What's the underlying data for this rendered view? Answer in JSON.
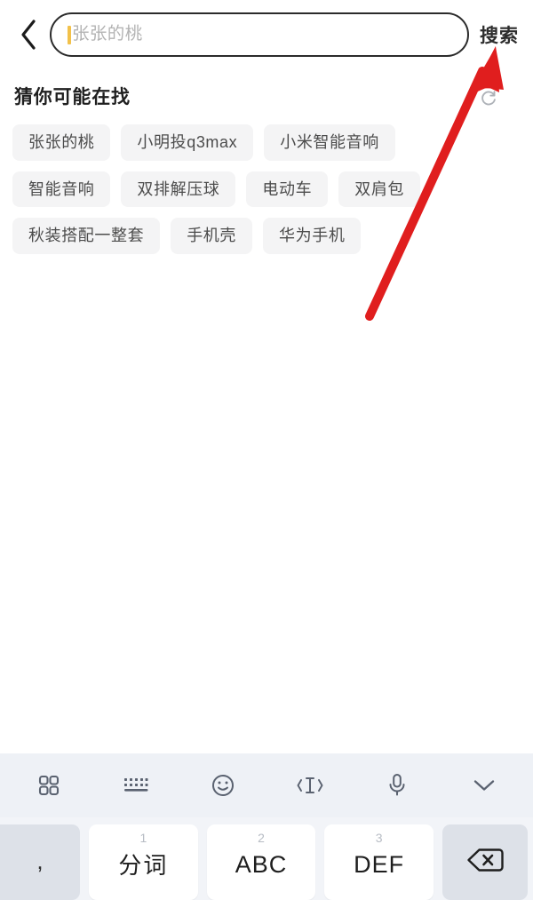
{
  "header": {
    "back_icon": "chevron-left-icon",
    "search_input": {
      "value": "",
      "placeholder": "张张的桃",
      "caret_color": "#f2c14a"
    },
    "search_button_label": "搜索"
  },
  "suggestions": {
    "title": "猜你可能在找",
    "refresh_icon": "refresh-icon",
    "rows": [
      [
        "张张的桃",
        "小明投q3max",
        "小米智能音响"
      ],
      [
        "智能音响",
        "双排解压球",
        "电动车",
        "双肩包"
      ],
      [
        "秋装搭配一整套",
        "手机壳",
        "华为手机"
      ]
    ]
  },
  "keyboard": {
    "toolbar_icons": [
      "grid-apps-icon",
      "keyboard-icon",
      "emoji-smiley-icon",
      "text-cursor-icon",
      "microphone-icon",
      "chevron-down-icon"
    ],
    "keys": [
      {
        "name": "comma-key",
        "label": ",",
        "num": ""
      },
      {
        "name": "fenci-key",
        "label": "分词",
        "num": "1"
      },
      {
        "name": "abc-key",
        "label": "ABC",
        "num": "2"
      },
      {
        "name": "def-key",
        "label": "DEF",
        "num": "3"
      },
      {
        "name": "backspace-key",
        "label": "",
        "num": ""
      }
    ]
  },
  "annotation": {
    "arrow_color": "#e01e1e",
    "points_to": "搜索"
  },
  "colors": {
    "chip_bg": "#f4f4f5",
    "chip_text": "#4c4c4c",
    "keyboard_bg": "#eef1f6",
    "accent_red": "#e01e1e"
  }
}
